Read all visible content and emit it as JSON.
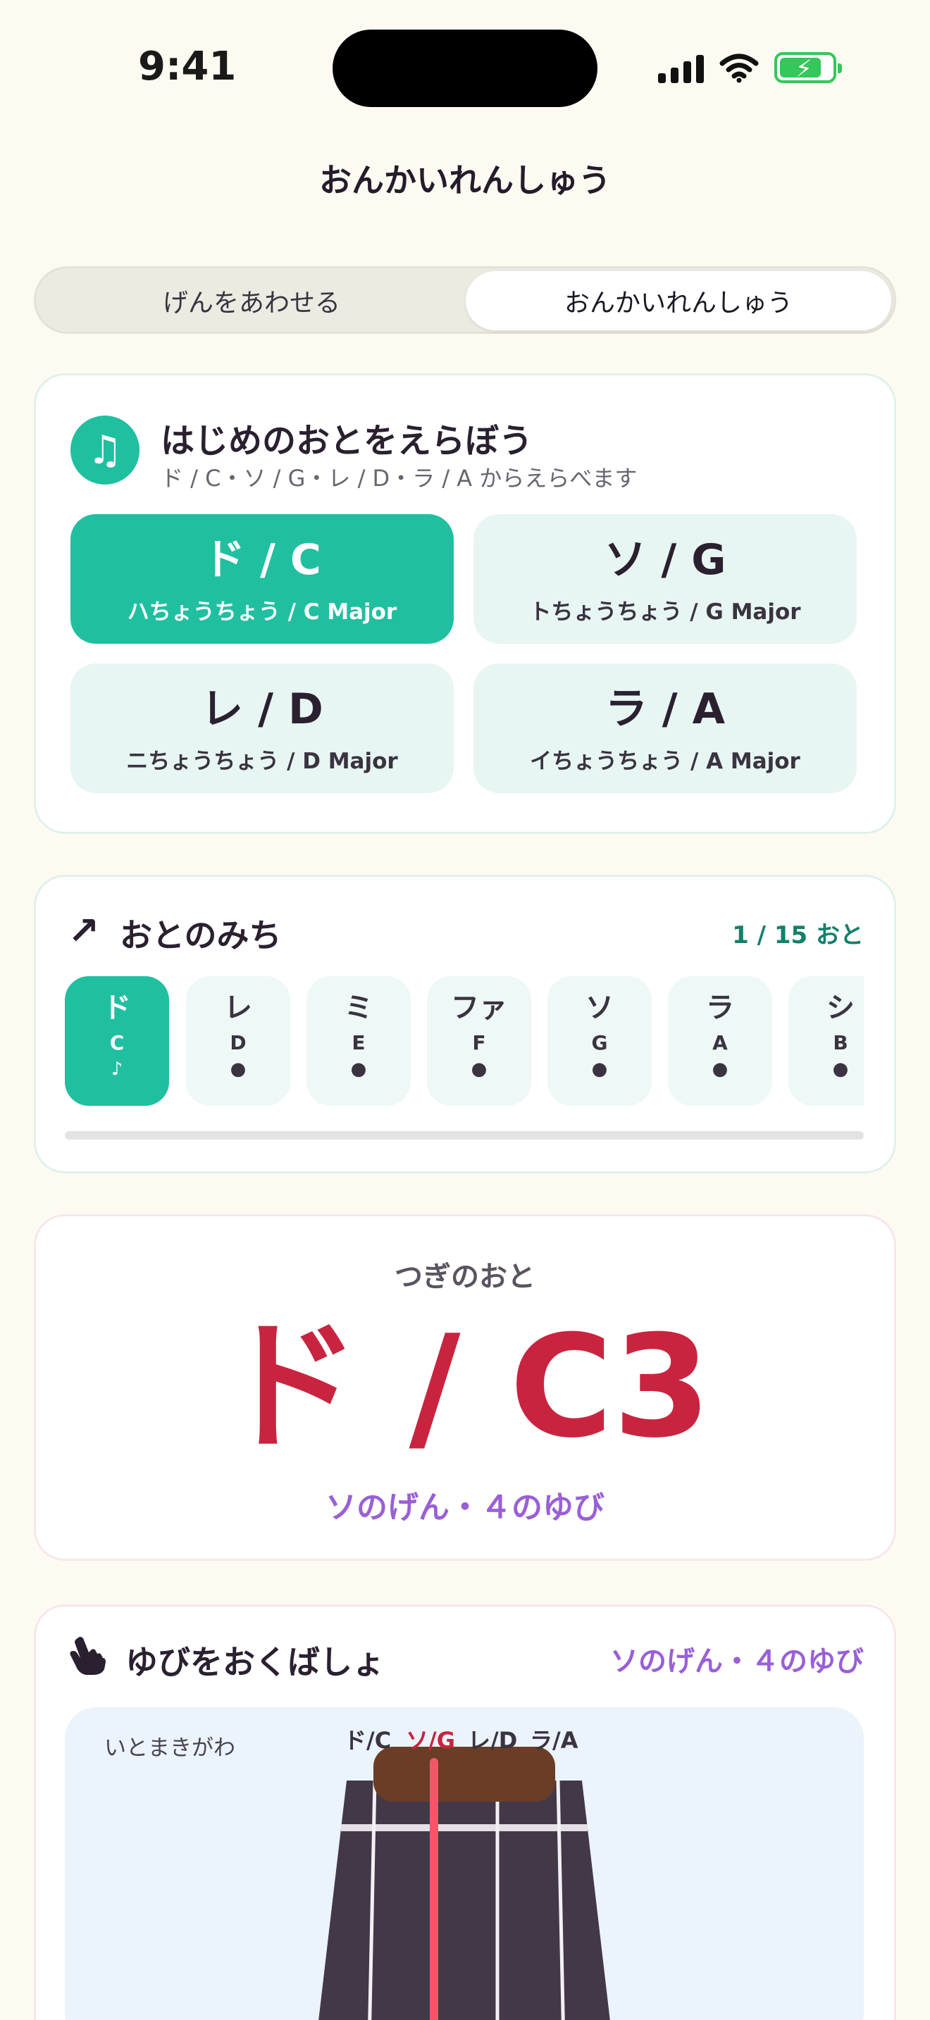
{
  "status": {
    "time": "9:41"
  },
  "page_title": "おんかいれんしゅう",
  "segments": {
    "left": "げんをあわせる",
    "right": "おんかいれんしゅう",
    "selected": "right"
  },
  "scale_card": {
    "icon": "music-note-icon",
    "title": "はじめのおとをえらぼう",
    "subtitle": "ド / C・ソ / G・レ / D・ラ / A からえらべます",
    "keys": [
      {
        "label": "ド / C",
        "sub": "ハちょうちょう / C Major",
        "active": true
      },
      {
        "label": "ソ / G",
        "sub": "トちょうちょう / G Major",
        "active": false
      },
      {
        "label": "レ / D",
        "sub": "ニちょうちょう / D Major",
        "active": false
      },
      {
        "label": "ラ / A",
        "sub": "イちょうちょう / A Major",
        "active": false
      }
    ]
  },
  "path_card": {
    "icon": "arrow-up-right-icon",
    "arrow": "↗",
    "title": "おとのみち",
    "count": "1 / 15 おと",
    "progress": 0.0,
    "notes": [
      {
        "jp": "ド",
        "en": "C",
        "mark": "♪",
        "active": true
      },
      {
        "jp": "レ",
        "en": "D",
        "mark": "●",
        "active": false
      },
      {
        "jp": "ミ",
        "en": "E",
        "mark": "●",
        "active": false
      },
      {
        "jp": "ファ",
        "en": "F",
        "mark": "●",
        "active": false
      },
      {
        "jp": "ソ",
        "en": "G",
        "mark": "●",
        "active": false
      },
      {
        "jp": "ラ",
        "en": "A",
        "mark": "●",
        "active": false
      },
      {
        "jp": "シ",
        "en": "B",
        "mark": "●",
        "active": false
      }
    ]
  },
  "next_card": {
    "label": "つぎのおと",
    "note": "ド / C3",
    "hint": "ソのげん・４のゆび"
  },
  "finger_card": {
    "icon": "pointing-hand-icon",
    "title": "ゆびをおくばしょ",
    "hint": "ソのげん・４のゆび",
    "tuning_side": "いとまきがわ",
    "strings": [
      "ド/C",
      "ソ/G",
      "レ/D",
      "ラ/A"
    ],
    "highlight_string": "ソ/G"
  },
  "colors": {
    "accent": "#20bfa0",
    "note_red": "#c9243f",
    "hint_purple": "#9a5fd6",
    "neck": "#433847",
    "nut": "#6b3d26"
  }
}
